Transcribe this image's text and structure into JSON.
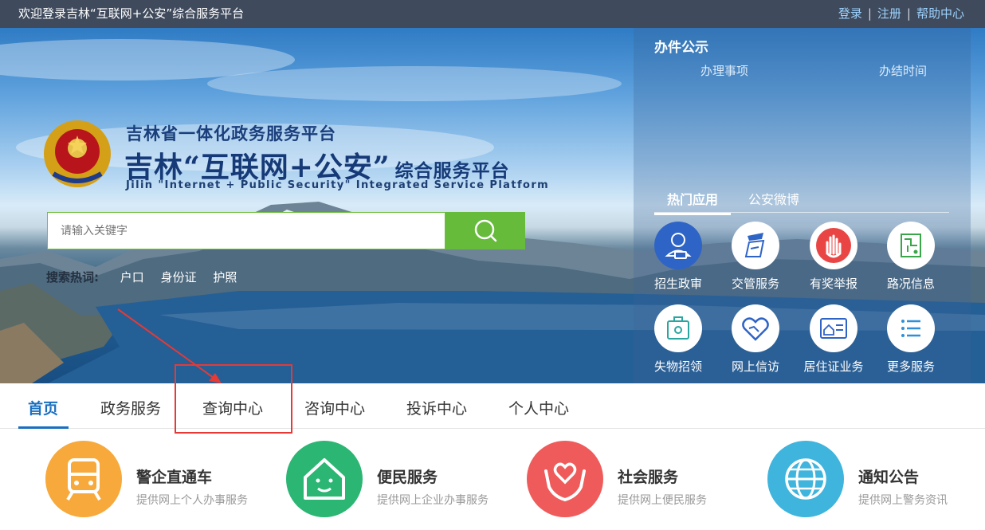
{
  "topbar": {
    "welcome": "欢迎登录吉林“互联网+公安”综合服务平台",
    "login": "登录",
    "register": "注册",
    "help": "帮助中心",
    "separator": "|"
  },
  "brand": {
    "subtitle": "吉林省一体化政务服务平台",
    "title": "吉林“互联网+公安”",
    "title_suffix": "综合服务平台",
    "title_en": "Jilin \"Internet + Public Security\" Integrated Service Platform"
  },
  "search": {
    "placeholder": "请输入关键字",
    "hot_label": "搜索热词:",
    "hot_words": [
      "户口",
      "身份证",
      "护照"
    ]
  },
  "panel": {
    "title": "办件公示",
    "col_item": "办理事项",
    "col_time": "办结时间",
    "tabs": [
      "热门应用",
      "公安微博"
    ],
    "apps": [
      {
        "label": "招生政审",
        "icon": "user-check-icon"
      },
      {
        "label": "交管服务",
        "icon": "traffic-police-icon"
      },
      {
        "label": "有奖举报",
        "icon": "hand-stop-icon"
      },
      {
        "label": "路况信息",
        "icon": "road-map-icon"
      },
      {
        "label": "失物招领",
        "icon": "lost-found-bag-icon"
      },
      {
        "label": "网上信访",
        "icon": "handshake-heart-icon"
      },
      {
        "label": "居住证业务",
        "icon": "residence-card-icon"
      },
      {
        "label": "更多服务",
        "icon": "list-icon"
      }
    ]
  },
  "nav": {
    "items": [
      "首页",
      "政务服务",
      "查询中心",
      "咨询中心",
      "投诉中心",
      "个人中心"
    ]
  },
  "features": [
    {
      "title": "警企直通车",
      "desc": "提供网上个人办事服务",
      "color": "#f7a93b",
      "icon": "train-icon"
    },
    {
      "title": "便民服务",
      "desc": "提供网上企业办事服务",
      "color": "#2bb673",
      "icon": "smile-house-icon"
    },
    {
      "title": "社会服务",
      "desc": "提供网上便民服务",
      "color": "#ef5b5b",
      "icon": "heart-hands-icon"
    },
    {
      "title": "通知公告",
      "desc": "提供网上警务资讯",
      "color": "#3fb4dc",
      "icon": "globe-icon"
    }
  ],
  "colors": {
    "topbar_bg": "#3f4a5c",
    "accent_blue": "#1a6fc0",
    "search_green": "#66bb3a",
    "highlight_red": "#e53a36"
  }
}
